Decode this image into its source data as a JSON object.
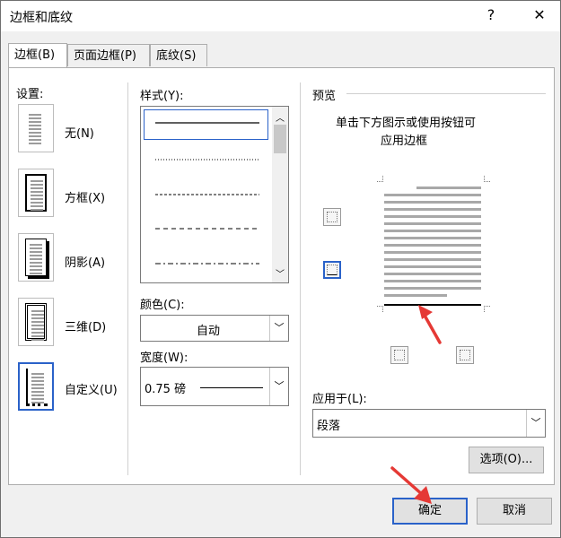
{
  "window": {
    "title": "边框和底纹",
    "help": "?",
    "close": "✕"
  },
  "tabs": [
    {
      "label": "边框(B)"
    },
    {
      "label": "页面边框(P)"
    },
    {
      "label": "底纹(S)"
    }
  ],
  "setting": {
    "label": "设置:",
    "options": [
      {
        "label": "无(N)"
      },
      {
        "label": "方框(X)"
      },
      {
        "label": "阴影(A)"
      },
      {
        "label": "三维(D)"
      },
      {
        "label": "自定义(U)",
        "selected": true
      }
    ]
  },
  "style": {
    "label": "样式(Y):",
    "options": [
      "solid",
      "dotted",
      "dashed-small",
      "dashed",
      "dash-dot"
    ]
  },
  "color": {
    "label": "颜色(C):",
    "value": "自动"
  },
  "width": {
    "label": "宽度(W):",
    "value": "0.75 磅"
  },
  "preview": {
    "label": "预览",
    "hint_line1": "单击下方图示或使用按钮可",
    "hint_line2": "应用边框"
  },
  "apply_to": {
    "label": "应用于(L):",
    "value": "段落"
  },
  "buttons": {
    "options": "选项(O)...",
    "ok": "确定",
    "cancel": "取消"
  },
  "colors": {
    "accent": "#2a62c9",
    "arrow": "#e53935"
  }
}
